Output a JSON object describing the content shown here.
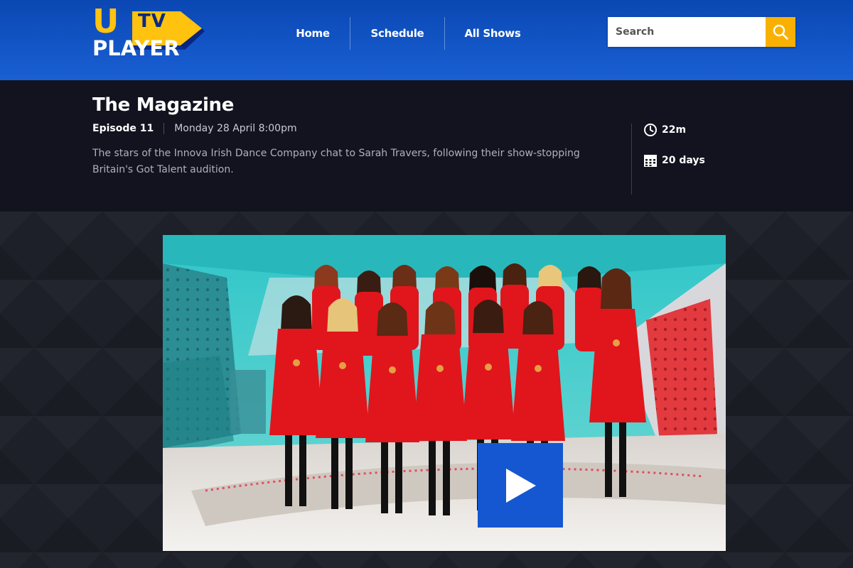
{
  "header": {
    "logo": {
      "letter": "U",
      "tv": "TV",
      "player": "PLAYER"
    },
    "nav": [
      {
        "label": "Home"
      },
      {
        "label": "Schedule"
      },
      {
        "label": "All Shows"
      }
    ],
    "search": {
      "placeholder": "Search",
      "value": "",
      "icon": "search-icon"
    }
  },
  "programme": {
    "title": "The Magazine",
    "episode": "Episode 11",
    "airdate": "Monday 28 April 8:00pm",
    "description": "The stars of the Innova Irish Dance Company chat to Sarah Travers, following their show-stopping Britain's Got Talent audition.",
    "duration": {
      "icon": "clock-icon",
      "value": "22m"
    },
    "availability": {
      "icon": "calendar-icon",
      "value": "20 days"
    }
  },
  "player": {
    "thumbnail": "group of dancers in red dresses on TV studio set",
    "play_icon": "play-icon"
  },
  "colors": {
    "header_blue": "#1356c7",
    "logo_yellow": "#ffc20e",
    "search_button": "#f9b000",
    "info_bg": "#12131f",
    "play_button": "#1557d0",
    "dress_red": "#e0161c"
  }
}
